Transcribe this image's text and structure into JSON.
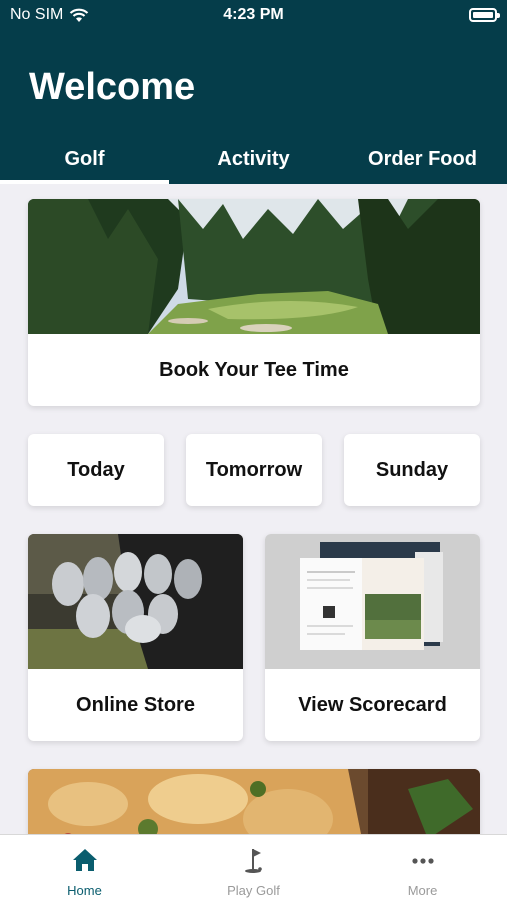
{
  "status": {
    "carrier": "No SIM",
    "time": "4:23 PM"
  },
  "header": {
    "title": "Welcome"
  },
  "tabs": [
    {
      "label": "Golf",
      "active": true
    },
    {
      "label": "Activity",
      "active": false
    },
    {
      "label": "Order Food",
      "active": false
    }
  ],
  "cards": {
    "tee_time": "Book Your Tee Time",
    "days": [
      "Today",
      "Tomorrow",
      "Sunday"
    ],
    "store": "Online Store",
    "scorecard": "View Scorecard"
  },
  "bottom_nav": [
    {
      "label": "Home",
      "icon": "home-icon",
      "active": true
    },
    {
      "label": "Play Golf",
      "icon": "golf-flag-icon",
      "active": false
    },
    {
      "label": "More",
      "icon": "more-dots-icon",
      "active": false
    }
  ],
  "colors": {
    "header_bg": "#053d4a",
    "accent": "#0a5d6e",
    "page_bg": "#f0eff4"
  }
}
